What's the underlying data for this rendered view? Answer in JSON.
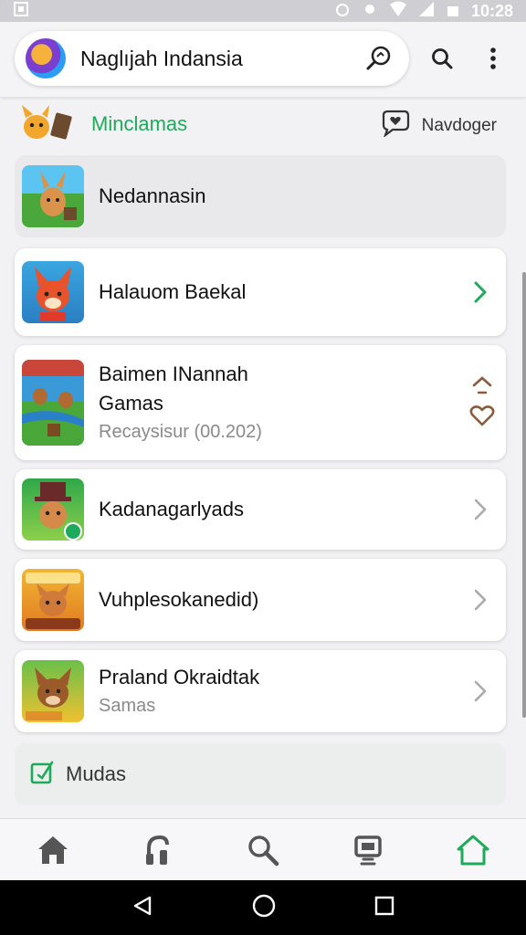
{
  "status_bar": {
    "time": "10:28"
  },
  "header": {
    "title": "Naglıjah Indansia"
  },
  "section": {
    "title": "Minclamas",
    "action_label": "Navdoger"
  },
  "items": [
    {
      "name": "Nedannasin",
      "subtitle": "",
      "trailing": "none"
    },
    {
      "name": "Halauom Baekal",
      "subtitle": "",
      "trailing": "chevron-green"
    },
    {
      "name": "Baimen INannah Gamas",
      "subtitle": "Recaysisur (00.202)",
      "trailing": "up-heart"
    },
    {
      "name": "Kadanagarlyads",
      "subtitle": "",
      "trailing": "chevron"
    },
    {
      "name": "Vuhplesokanedid)",
      "subtitle": "",
      "trailing": "chevron"
    },
    {
      "name": "Praland Okraidtak",
      "subtitle": "Samas",
      "trailing": "chevron"
    }
  ],
  "footer_item": {
    "label": "Mudas"
  },
  "colors": {
    "accent_green": "#1eaa5b",
    "heart_brown": "#8a5a3a"
  }
}
